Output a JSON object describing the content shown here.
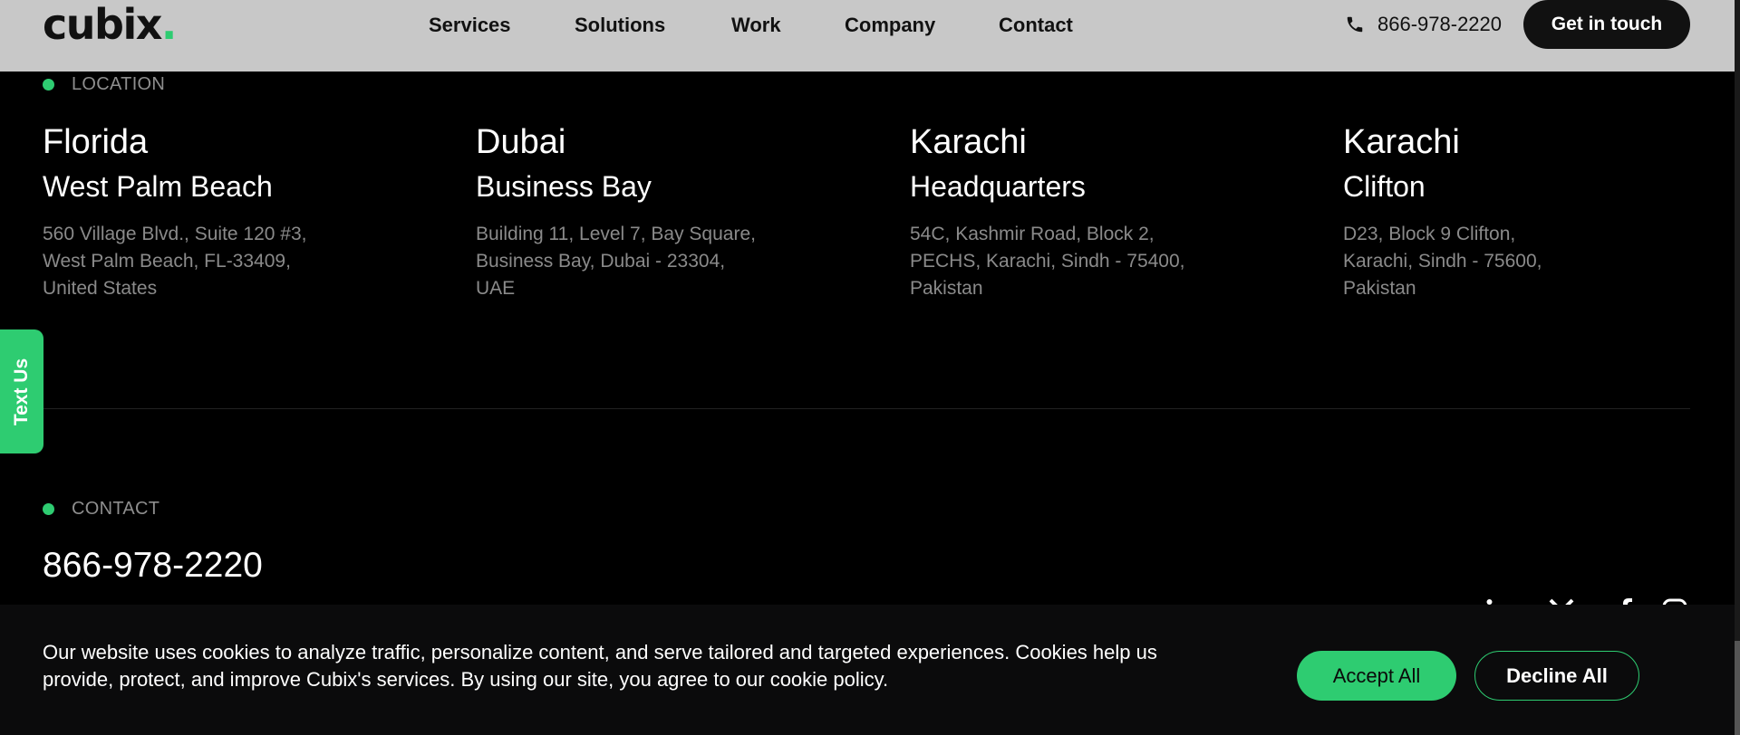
{
  "header": {
    "logo_text": "cubix",
    "logo_dot": ".",
    "nav": [
      "Services",
      "Solutions",
      "Work",
      "Company",
      "Contact"
    ],
    "phone": "866-978-2220",
    "cta": "Get in touch"
  },
  "location": {
    "label": "LOCATION",
    "items": [
      {
        "city": "Florida",
        "area": "West Palm Beach",
        "address": [
          "560 Village Blvd., Suite 120 #3,",
          "West Palm Beach, FL-33409,",
          "United States"
        ]
      },
      {
        "city": "Dubai",
        "area": "Business Bay",
        "address": [
          "Building 11, Level 7, Bay Square,",
          "Business Bay, Dubai - 23304,",
          "UAE"
        ]
      },
      {
        "city": "Karachi",
        "area": "Headquarters",
        "address": [
          "54C, Kashmir Road, Block 2,",
          "PECHS, Karachi, Sindh - 75400,",
          "Pakistan"
        ]
      },
      {
        "city": "Karachi",
        "area": "Clifton",
        "address": [
          "D23, Block 9 Clifton,",
          "Karachi, Sindh - 75600,",
          "Pakistan"
        ]
      }
    ]
  },
  "text_us": "Text Us",
  "contact": {
    "label": "CONTACT",
    "phone": "866-978-2220"
  },
  "cookie": {
    "text": "Our website uses cookies to analyze traffic, personalize content, and serve tailored and targeted experiences. Cookies help us provide, protect, and improve Cubix's services. By using our site, you agree to our cookie policy.",
    "accept": "Accept All",
    "decline": "Decline All"
  },
  "colors": {
    "accent": "#2ecc71",
    "header_bg": "#c8c8c8",
    "page_bg": "#000000"
  }
}
